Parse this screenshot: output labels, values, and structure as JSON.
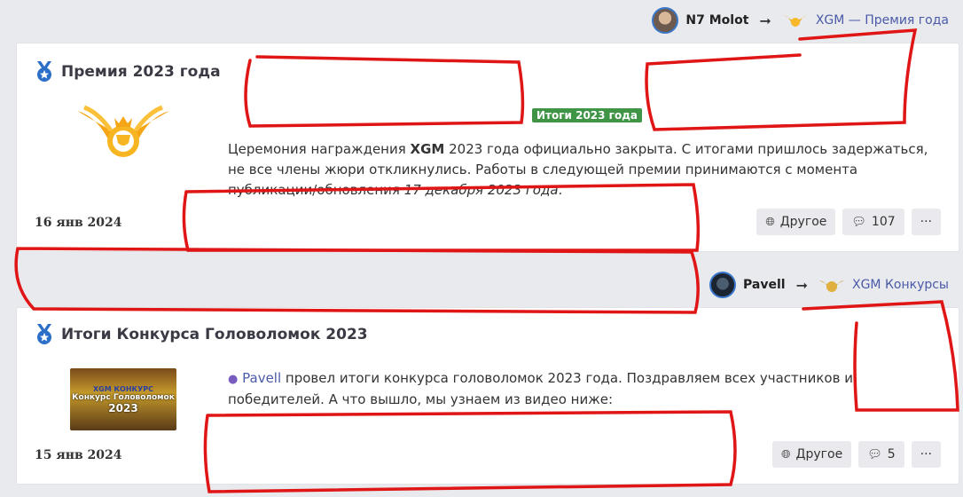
{
  "posts": [
    {
      "author": "N7 Molot",
      "group": "XGM — Премия года",
      "title": "Премия 2023 года",
      "tag": "Итоги 2023 года",
      "text_part1": "Церемония награждения ",
      "text_bold": "XGM",
      "text_part2": " 2023 года официально закрыта. С итогами пришлось задержаться, не все члены жюри откликнулись. Работы в следующей премии принимаются с момента публикации/обновления ",
      "text_italic": "17 декабря 2023 года",
      "text_part3": ".",
      "date": "16 янв 2024",
      "category": "Другое",
      "comments": "107",
      "more": "···"
    },
    {
      "author": "Pavell",
      "group": "XGM Конкурсы",
      "title": "Итоги Конкурса Головоломок 2023",
      "text_user": "Pavell",
      "text_rest": " провел итоги конкурса головоломок 2023 года. Поздравляем всех участников и победителей. А что вышло, мы узнаем из видео ниже:",
      "thumb_line1": "XGM КОНКУРС",
      "thumb_line2": "Конкурс Головоломок",
      "thumb_line3": "2023",
      "date": "15 янв 2024",
      "category": "Другое",
      "comments": "5",
      "more": "···"
    }
  ],
  "colors": {
    "accent": "#4a5aa8",
    "tag_green": "#3f9446",
    "scribble": "#e01515"
  },
  "icons": [
    "medal-icon",
    "globe-icon",
    "comment-icon",
    "user-icon",
    "wings-trophy-icon"
  ]
}
